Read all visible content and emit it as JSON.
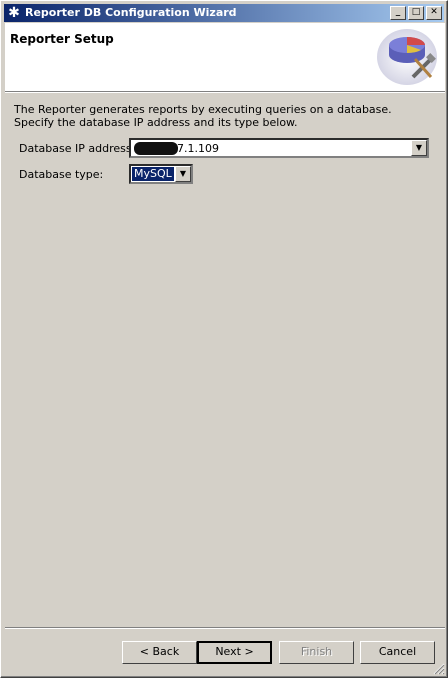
{
  "window": {
    "title": "Reporter DB Configuration Wizard",
    "icon": "app-logo-icon"
  },
  "header": {
    "title": "Reporter Setup",
    "icon": "database-tools-icon"
  },
  "description": "The Reporter generates reports by executing queries on a database. Specify the database IP address and its type below.",
  "form": {
    "ip_label": "Database IP address:",
    "ip_value": "7.1.109",
    "type_label": "Database type:",
    "type_value": "MySQL"
  },
  "buttons": {
    "back": "< Back",
    "next": "Next >",
    "finish": "Finish",
    "cancel": "Cancel"
  }
}
